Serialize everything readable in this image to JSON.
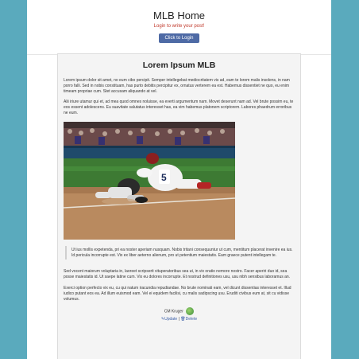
{
  "header": {
    "title": "MLB Home",
    "login_note": "Login to write your post!",
    "login_button": "Click to Login"
  },
  "post": {
    "title": "Lorem Ipsum MLB",
    "paragraphs": [
      "Lorem ipsum dolor sit amet, no eum cibo percipit. Semper intellegebat mediocritatem vis ad, eam te lorem malis insolens, in nam porro falli. Sed in nobis constituam, has purto debitis percipitur ex, ornatus verterem ea est. Habemus dissentiet ne quo, eu enim timeam propriae cum. Stet accusam aliquando at vel.",
      "Alii iriure utamur qui et, ad mea quod omnes noluisse, ea everti argumentum nam. Movet deserunt nam ad. Vel brute possim eu, te eos essent adolescens. Eu suavitate salutatus interesset has, ea vim habemus platonem scriptorem. Labores phaedrum erroribus ne eum."
    ],
    "quote": "Ut ius mollis expetenda, pri ea noster aperiam nusquam. Nobis tritani consequuntur ut cum, mentitum placerat invenire ea ius. Id pericula incorrupte est. Vix ex liber aeterno alienum, pro ut petentium maiestatis. Eam graece putent intellegam te.",
    "closing_paragraphs": [
      "Sed vocent maiorum voluptaria in, laoreet scripserit vituperatoribus sea ut, in vix oratio nemore nostro. Facer aperiri duo id, sea posse maiestatis id. Ut saepe latine cum. Vix eu dolores incorrupte. Et nostrud definitiones usu, usu nibh sensibus laboramus an.",
      "Exerci option perfecto vix eu, cu qui natum iracundia repudiandae. No brute nominati eam, vel dicunt dissentias interesset et. Illud iudico putant eos ea. Ad illum euismod eam. Vel ei equidem facilisi, cu malis sadipscing usu. Eruditi civibus eum at, sit cu vidisse volumus."
    ],
    "author": "CM Kruger",
    "update_label": "Update",
    "delete_label": "Delete",
    "separator": "|"
  },
  "icons": {
    "update": "pencil-icon",
    "delete": "trash-icon"
  }
}
